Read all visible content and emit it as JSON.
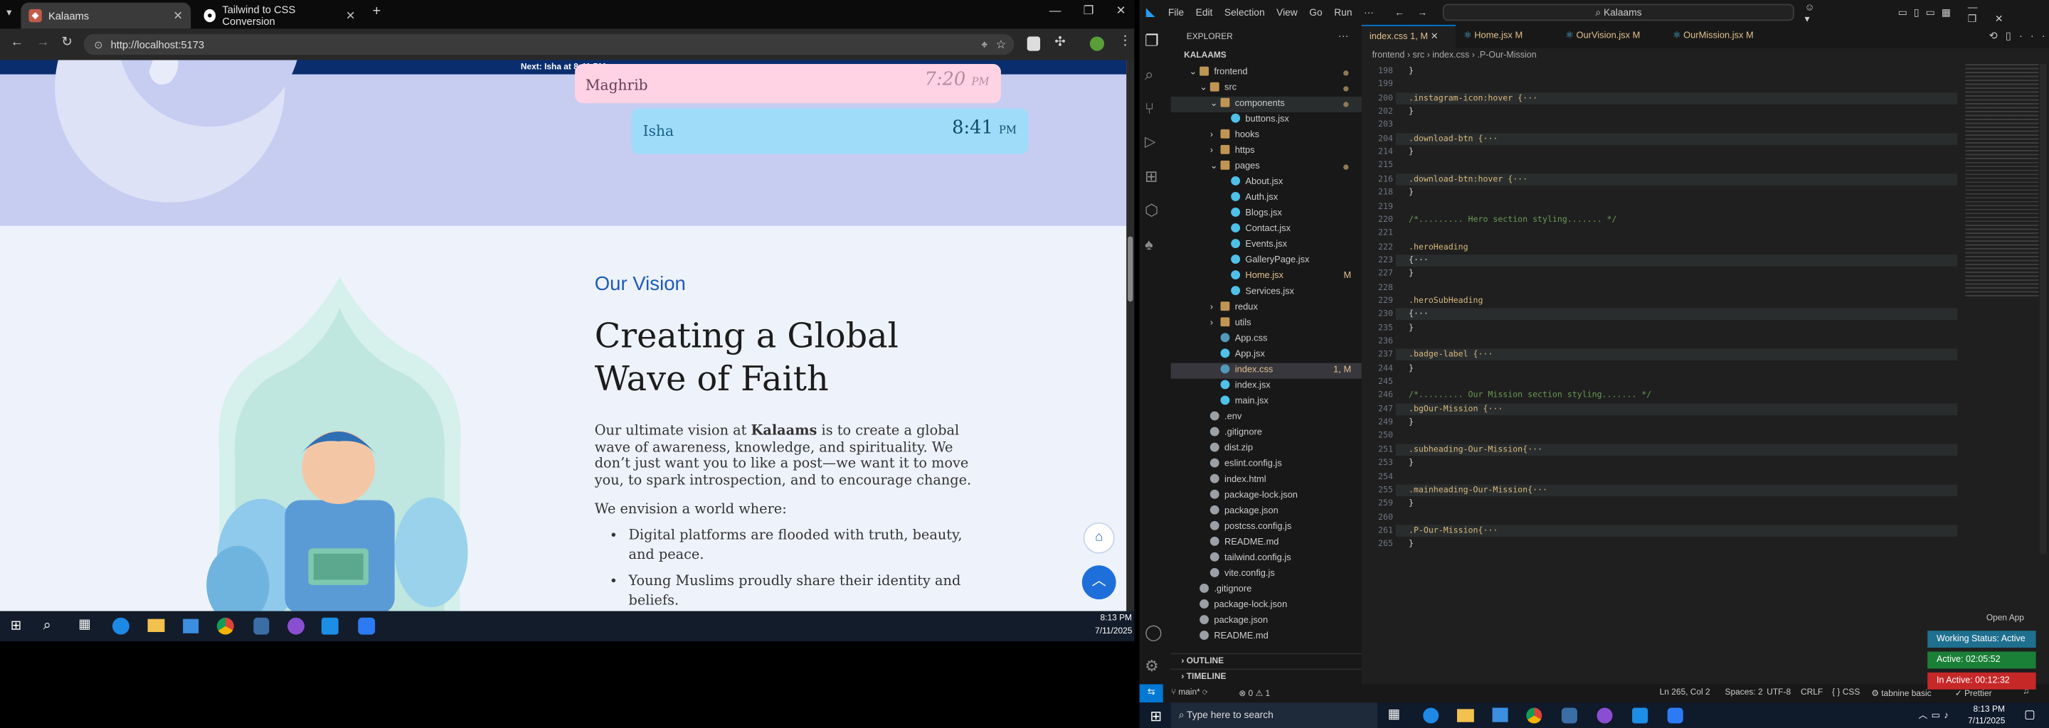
{
  "chrome": {
    "tabs": [
      {
        "title": "Kalaams",
        "active": true
      },
      {
        "title": "Tailwind to CSS Conversion",
        "active": false
      }
    ],
    "url": "http://localhost:5173"
  },
  "website": {
    "next_prayer": "Next: Isha at 8:41 PM",
    "prayers": [
      {
        "name": "Maghrib",
        "time": "7:20",
        "ampm": "PM"
      },
      {
        "name": "Isha",
        "time": "8:41",
        "ampm": "PM"
      }
    ],
    "vision": {
      "eyebrow": "Our Vision",
      "heading_line1": "Creating a Global",
      "heading_line2": "Wave of Faith",
      "para_before": "Our ultimate vision at ",
      "para_brand": "Kalaams",
      "para_after": " is to create a global wave of awareness, knowledge, and spirituality. We don’t just want you to like a post—we want it to move you, to spark introspection, and to encourage change.",
      "envision": "We envision a world where:",
      "bullets": [
        "Digital platforms are flooded with truth, beauty, and peace.",
        "Young Muslims proudly share their identity and beliefs."
      ]
    }
  },
  "taskbar_left": {
    "time": "8:13 PM",
    "date": "7/11/2025"
  },
  "vscode": {
    "menu": [
      "File",
      "Edit",
      "Selection",
      "View",
      "Go",
      "Run",
      "···"
    ],
    "search": "Kalaams",
    "explorer_title": "EXPLORER",
    "root": "KALAAMS",
    "tree": [
      {
        "label": "frontend",
        "type": "folder-open",
        "depth": 1,
        "dot": true
      },
      {
        "label": "src",
        "type": "folder-open",
        "depth": 2,
        "dot": true
      },
      {
        "label": "components",
        "type": "folder-open",
        "depth": 3,
        "dot": true,
        "highlight": true
      },
      {
        "label": "buttons.jsx",
        "type": "file",
        "depth": 4
      },
      {
        "label": "hooks",
        "type": "folder",
        "depth": 3
      },
      {
        "label": "https",
        "type": "folder",
        "depth": 3
      },
      {
        "label": "pages",
        "type": "folder-open",
        "depth": 3,
        "dot": true
      },
      {
        "label": "About.jsx",
        "type": "file",
        "depth": 4
      },
      {
        "label": "Auth.jsx",
        "type": "file",
        "depth": 4
      },
      {
        "label": "Blogs.jsx",
        "type": "file",
        "depth": 4
      },
      {
        "label": "Contact.jsx",
        "type": "file",
        "depth": 4
      },
      {
        "label": "Events.jsx",
        "type": "file",
        "depth": 4
      },
      {
        "label": "GalleryPage.jsx",
        "type": "file",
        "depth": 4
      },
      {
        "label": "Home.jsx",
        "type": "file",
        "depth": 4,
        "status": "M",
        "modified": true
      },
      {
        "label": "Services.jsx",
        "type": "file",
        "depth": 4
      },
      {
        "label": "redux",
        "type": "folder",
        "depth": 3
      },
      {
        "label": "utils",
        "type": "folder",
        "depth": 3
      },
      {
        "label": "App.css",
        "type": "css",
        "depth": 3
      },
      {
        "label": "App.jsx",
        "type": "file",
        "depth": 3
      },
      {
        "label": "index.css",
        "type": "css",
        "depth": 3,
        "status": "1, M",
        "selected": true
      },
      {
        "label": "index.jsx",
        "type": "file",
        "depth": 3
      },
      {
        "label": "main.jsx",
        "type": "file",
        "depth": 3
      },
      {
        "label": ".env",
        "type": "plain",
        "depth": 2
      },
      {
        "label": ".gitignore",
        "type": "plain",
        "depth": 2
      },
      {
        "label": "dist.zip",
        "type": "plain",
        "depth": 2
      },
      {
        "label": "eslint.config.js",
        "type": "plain",
        "depth": 2
      },
      {
        "label": "index.html",
        "type": "plain",
        "depth": 2
      },
      {
        "label": "package-lock.json",
        "type": "plain",
        "depth": 2
      },
      {
        "label": "package.json",
        "type": "plain",
        "depth": 2
      },
      {
        "label": "postcss.config.js",
        "type": "plain",
        "depth": 2
      },
      {
        "label": "README.md",
        "type": "plain",
        "depth": 2
      },
      {
        "label": "tailwind.config.js",
        "type": "plain",
        "depth": 2
      },
      {
        "label": "vite.config.js",
        "type": "plain",
        "depth": 2
      },
      {
        "label": ".gitignore",
        "type": "plain",
        "depth": 1
      },
      {
        "label": "package-lock.json",
        "type": "plain",
        "depth": 1
      },
      {
        "label": "package.json",
        "type": "plain",
        "depth": 1
      },
      {
        "label": "README.md",
        "type": "plain",
        "depth": 1
      }
    ],
    "outline": "OUTLINE",
    "timeline": "TIMELINE",
    "tabs": [
      {
        "label": "index.css",
        "suffix": "1, M",
        "active": true
      },
      {
        "label": "Home.jsx",
        "suffix": "M"
      },
      {
        "label": "OurVision.jsx",
        "suffix": "M"
      },
      {
        "label": "OurMission.jsx",
        "suffix": "M"
      }
    ],
    "breadcrumb": [
      "frontend",
      "src",
      "index.css",
      ".P-Our-Mission"
    ],
    "code": [
      {
        "n": "198",
        "t": "}"
      },
      {
        "n": "199",
        "t": ""
      },
      {
        "n": "200",
        "t": ".instagram-icon:hover {···"
      },
      {
        "n": "202",
        "t": "}"
      },
      {
        "n": "203",
        "t": ""
      },
      {
        "n": "204",
        "t": ".download-btn {···"
      },
      {
        "n": "214",
        "t": "}"
      },
      {
        "n": "215",
        "t": ""
      },
      {
        "n": "216",
        "t": ".download-btn:hover {···"
      },
      {
        "n": "218",
        "t": "}"
      },
      {
        "n": "219",
        "t": ""
      },
      {
        "n": "220",
        "t": "/*......... Hero section styling....... */"
      },
      {
        "n": "221",
        "t": ""
      },
      {
        "n": "222",
        "t": ".heroHeading"
      },
      {
        "n": "223",
        "t": "{···"
      },
      {
        "n": "227",
        "t": "}"
      },
      {
        "n": "228",
        "t": ""
      },
      {
        "n": "229",
        "t": ".heroSubHeading"
      },
      {
        "n": "230",
        "t": "{···"
      },
      {
        "n": "235",
        "t": "}"
      },
      {
        "n": "236",
        "t": ""
      },
      {
        "n": "237",
        "t": ".badge-label {···"
      },
      {
        "n": "244",
        "t": "}"
      },
      {
        "n": "245",
        "t": ""
      },
      {
        "n": "246",
        "t": "/*......... Our Mission section styling....... */"
      },
      {
        "n": "247",
        "t": ".bgOur-Mission {···"
      },
      {
        "n": "249",
        "t": "}"
      },
      {
        "n": "250",
        "t": ""
      },
      {
        "n": "251",
        "t": ".subheading-Our-Mission{···"
      },
      {
        "n": "253",
        "t": "}"
      },
      {
        "n": "254",
        "t": ""
      },
      {
        "n": "255",
        "t": ".mainheading-Our-Mission{···"
      },
      {
        "n": "259",
        "t": "}"
      },
      {
        "n": "260",
        "t": ""
      },
      {
        "n": "261",
        "t": ".P-Our-Mission{···"
      },
      {
        "n": "265",
        "t": "}"
      }
    ],
    "status": {
      "branch": "main*",
      "problems": "⊗ 0 ⚠ 1",
      "position": "Ln 265, Col 2",
      "spaces": "Spaces: 2",
      "encoding": "UTF-8",
      "eol": "CRLF",
      "language": "CSS",
      "tabnine": "tabnine basic",
      "prettier": "Prettier"
    },
    "open_app": "Open App",
    "working_status": "Working Status: Active",
    "active_time": "Active: 02:05:52",
    "inactive_time": "In Active: 00:12:32"
  },
  "taskbar_right": {
    "search_placeholder": "Type here to search",
    "time": "8:13 PM",
    "date": "7/11/2025"
  },
  "colors": {
    "accent_blue": "#0a3d91",
    "vision_eyebrow": "#1e5bb8",
    "vscode_status_remote": "#0078d4",
    "badge_active": "#1a7f37",
    "badge_inactive": "#c62828"
  }
}
